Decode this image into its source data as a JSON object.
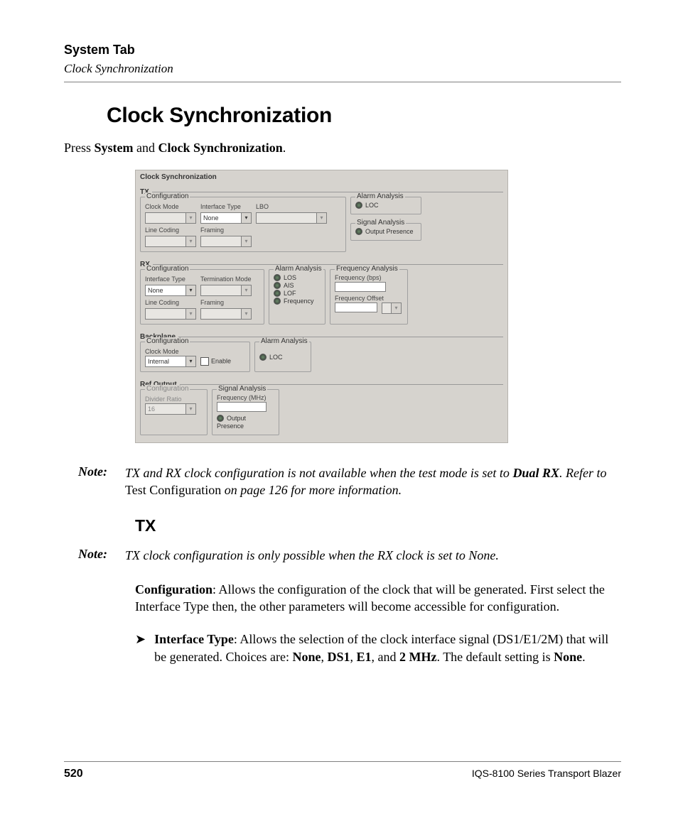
{
  "header": {
    "section": "System Tab",
    "subsection": "Clock Synchronization"
  },
  "title": "Clock Synchronization",
  "intro": {
    "pre": "Press ",
    "b1": "System",
    "mid": " and ",
    "b2": "Clock Synchronization",
    "post": "."
  },
  "screenshot": {
    "panel_title": "Clock Synchronization",
    "tx": {
      "label": "TX",
      "config": {
        "legend": "Configuration",
        "clock_mode": {
          "label": "Clock Mode",
          "value": ""
        },
        "interface_type": {
          "label": "Interface Type",
          "value": "None"
        },
        "lbo": {
          "label": "LBO",
          "value": ""
        },
        "line_coding": {
          "label": "Line Coding",
          "value": ""
        },
        "framing": {
          "label": "Framing",
          "value": ""
        }
      },
      "alarm": {
        "legend": "Alarm Analysis",
        "loc": "LOC"
      },
      "signal": {
        "legend": "Signal Analysis",
        "out": "Output Presence"
      }
    },
    "rx": {
      "label": "RX",
      "config": {
        "legend": "Configuration",
        "interface_type": {
          "label": "Interface Type",
          "value": "None"
        },
        "termination_mode": {
          "label": "Termination Mode",
          "value": ""
        },
        "line_coding": {
          "label": "Line Coding",
          "value": ""
        },
        "framing": {
          "label": "Framing",
          "value": ""
        }
      },
      "alarm": {
        "legend": "Alarm Analysis",
        "los": "LOS",
        "ais": "AIS",
        "lof": "LOF",
        "freq": "Frequency"
      },
      "freq": {
        "legend": "Frequency Analysis",
        "bps": "Frequency (bps)",
        "off": "Frequency Offset"
      }
    },
    "backplane": {
      "label": "Backplane",
      "config": {
        "legend": "Configuration",
        "clock_mode": {
          "label": "Clock Mode",
          "value": "Internal"
        },
        "enable": "Enable"
      },
      "alarm": {
        "legend": "Alarm Analysis",
        "loc": "LOC"
      }
    },
    "refout": {
      "label": "Ref Output",
      "config": {
        "legend": "Configuration",
        "divider": {
          "label": "Divider Ratio",
          "value": "16"
        }
      },
      "signal": {
        "legend": "Signal Analysis",
        "mhz": "Frequency (MHz)",
        "out": "Output Presence"
      }
    }
  },
  "note1": {
    "label": "Note:",
    "text_a": "TX and RX clock configuration is not available when the test mode is set to ",
    "bold": "Dual RX",
    "text_b": ". Refer to ",
    "roman": "Test Configuration",
    "text_c": " on page 126 for more information."
  },
  "tx_heading": "TX",
  "note2": {
    "label": "Note:",
    "text": "TX clock configuration is only possible when the RX clock is set to None."
  },
  "para_config": {
    "bold": "Configuration",
    "text": ": Allows the configuration of the clock that will be generated. First select the Interface Type then, the other parameters will become accessible for configuration."
  },
  "bullet_iftype": {
    "arrow": "➤",
    "bold": "Interface Type",
    "text_a": ": Allows the selection of the clock interface signal (DS1/E1/2M) that will be generated. Choices are: ",
    "b1": "None",
    "sep1": ", ",
    "b2": "DS1",
    "sep2": ", ",
    "b3": "E1",
    "sep3": ", and ",
    "b4": "2 MHz",
    "text_b": ". The default setting is ",
    "b5": "None",
    "text_c": "."
  },
  "footer": {
    "page": "520",
    "product": "IQS-8100 Series Transport Blazer"
  }
}
